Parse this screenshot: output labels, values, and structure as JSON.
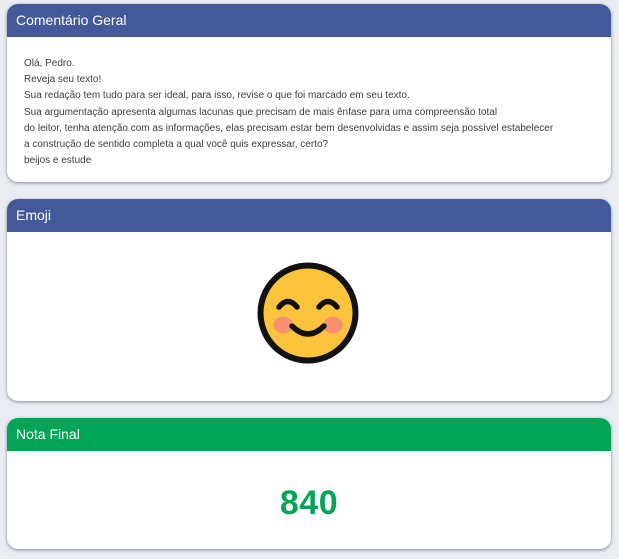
{
  "comment_card": {
    "title": "Comentário Geral",
    "lines": [
      "Olá, Pedro.",
      "Reveja seu texto!",
      "Sua redação tem tudo para ser ideal, para isso, revise o que foi marcado em seu texto.",
      "Sua argumentação apresenta algumas lacunas que precisam de mais ênfase para uma compreensão total",
      "do leitor, tenha atenção com as informações, elas precisam estar bem desenvolvidas e assim seja possível estabelecer",
      "a construção de sentido completa a qual você quis expressar, certo?",
      "beijos e estude"
    ]
  },
  "emoji_card": {
    "title": "Emoji",
    "emoji_icon": "smiling-face-with-smiling-eyes-icon"
  },
  "grade_card": {
    "title": "Nota Final",
    "value": "840"
  },
  "colors": {
    "header_blue": "#43599a",
    "header_green": "#00a656",
    "grade_text": "#00a656",
    "emoji_face": "#fcc43a",
    "emoji_cheeks": "#f7906f"
  }
}
